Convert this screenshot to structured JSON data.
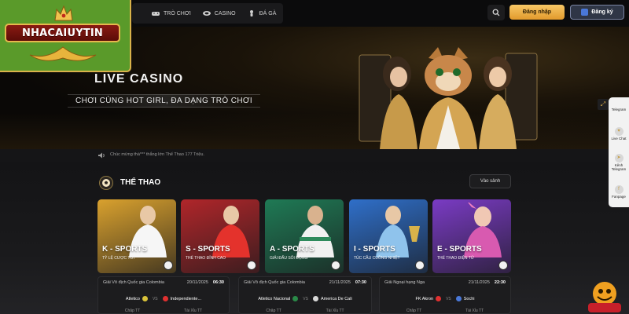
{
  "brand": {
    "logo_text": "NHACAIUYTIN"
  },
  "nav": {
    "items": [
      {
        "label": "TRÒ CHƠI",
        "icon": "gamepad-icon"
      },
      {
        "label": "CASINO",
        "icon": "casino-chip-icon"
      },
      {
        "label": "ĐÁ GÀ",
        "icon": "rooster-icon"
      }
    ]
  },
  "header": {
    "search_icon": "search-icon",
    "login_label": "Đăng nhập",
    "register_label": "Đăng ký"
  },
  "hero": {
    "title": "LIVE CASINO",
    "subtitle": "CHƠI CÙNG HOT GIRL, ĐA DẠNG TRÒ CHƠI"
  },
  "marquee": {
    "text": "Chúc mừng thà*** thắng lớn Thể Thao 177 Triệu."
  },
  "sports": {
    "title": "THỂ THAO",
    "lobby_label": "Vào sảnh",
    "cards": [
      {
        "title": "K - SPORTS",
        "subtitle": "TỶ LỆ CƯỢC TỐT",
        "bg": "#d9a12e"
      },
      {
        "title": "S - SPORTS",
        "subtitle": "THỂ THAO ĐỈNH CAO",
        "bg": "#b0262a"
      },
      {
        "title": "A - SPORTS",
        "subtitle": "GIẢI ĐẤU SÔI ĐỘNG",
        "bg": "#1f7a55"
      },
      {
        "title": "I - SPORTS",
        "subtitle": "TÚC CẦU CUỒNG NHIỆT",
        "bg": "#2f6fc9"
      },
      {
        "title": "E - SPORTS",
        "subtitle": "THỂ THAO ĐIỆN TỬ",
        "bg": "#7a3bc4"
      }
    ],
    "matches": [
      {
        "league": "Giải Vô địch Quốc gia Colombia",
        "date": "20/11/2025",
        "time": "06:30",
        "home": "Atletico",
        "away": "Independiente...",
        "odd_a": "Châp TT",
        "odd_b": "Tài Xỉu TT"
      },
      {
        "league": "Giải Vô địch Quốc gia Colombia",
        "date": "21/11/2025",
        "time": "07:30",
        "home": "Atletico Nacional",
        "away": "America De Cali",
        "odd_a": "Châp TT",
        "odd_b": "Tài Xỉu TT"
      },
      {
        "league": "Giải Ngoại hạng Nga",
        "date": "21/11/2025",
        "time": "22:30",
        "home": "FK Akron",
        "away": "Sochi",
        "odd_a": "Châp TT",
        "odd_b": "Tài Xỉu TT"
      }
    ],
    "vs": "VS"
  },
  "sidebar": {
    "items": [
      {
        "label": "Telegram",
        "icon": "telegram-icon"
      },
      {
        "label": "Live Chat",
        "icon": "heart-chat-icon"
      },
      {
        "label": "Kênh Telegram",
        "icon": "telegram-channel-icon"
      },
      {
        "label": "Fanpage",
        "icon": "facebook-icon"
      }
    ]
  }
}
